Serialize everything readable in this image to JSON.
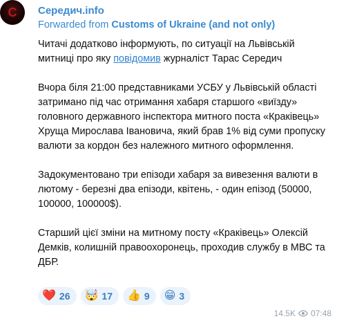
{
  "channel": {
    "name": "Середич.info",
    "forwarded_label": "Forwarded from",
    "forwarded_from": "Customs of Ukraine (and not only)"
  },
  "message": {
    "p1_before": "Читачі додатково інформують, по ситуації на Львівській митниці про яку ",
    "p1_link": "повідомив",
    "p1_after": " журналіст Тарас Середич",
    "p2": "Вчора біля 21:00 представниками УСБУ у Львівській області затримано під час отримання хабаря старшого «виїзду» головного державного інспектора митного поста «Краківець» Хруща Мирослава Івановича, який брав 1% від суми пропуску валюти за кордон без належного митного оформлення.",
    "p3": "Задокументовано три епізоди хабаря за вивезення валюти в лютому - березні два епізоди, квітень, - один епізод (50000, 100000, 100000$).",
    "p4": "Старший цієї зміни на митному посту «Краківець» Олексій Демків, колишній правоохоронець, проходив службу в МВС та ДБР."
  },
  "reactions": [
    {
      "emoji": "❤️",
      "count": "26"
    },
    {
      "emoji": "🤯",
      "count": "17"
    },
    {
      "emoji": "👍",
      "count": "9"
    },
    {
      "emoji": "😁",
      "count": "3"
    }
  ],
  "meta": {
    "views": "14.5K",
    "time": "07:48"
  },
  "colors": {
    "accent": "#3a8bd1",
    "link": "#2f82cf",
    "reaction_bg": "#eaf3fb",
    "meta_text": "#9aa3ab"
  }
}
